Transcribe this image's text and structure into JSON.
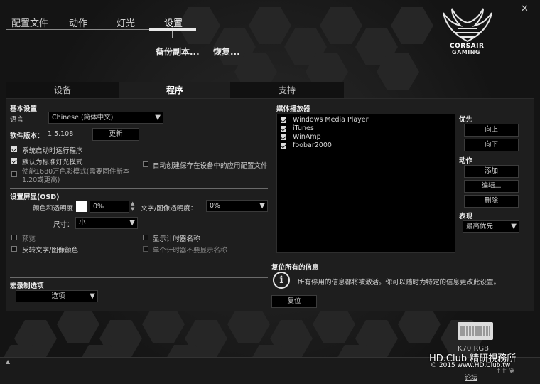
{
  "nav": {
    "tabs": [
      "配置文件",
      "动作",
      "灯光",
      "设置"
    ],
    "sub": [
      "备份副本...",
      "恢复..."
    ]
  },
  "window": {
    "min": "—",
    "close": "✕"
  },
  "logo": {
    "l1": "CORSAIR",
    "l2": "GAMING"
  },
  "tabs": [
    "设备",
    "程序",
    "支持"
  ],
  "basic": {
    "title": "基本设置",
    "lang_label": "语言",
    "lang_value": "Chinese (简体中文)",
    "ver_label": "软件版本：",
    "ver_value": "1.5.108",
    "update": "更新",
    "cb1": "系统启动时运行程序",
    "cb2": "默认为标准灯光模式",
    "cb3": "使能1680万色彩模式(需要固件新本1.20或更高)",
    "cb4": "自动创建保存在设备中的应用配置文件"
  },
  "osd": {
    "title": "设置屏显(OSD)",
    "color_label": "颜色和透明度",
    "color_value": "0%",
    "text_label": "文字/图像透明度：",
    "text_value": "0%",
    "size_label": "尺寸：",
    "size_value": "小",
    "preview": "预览",
    "invert": "反转文字/图像颜色",
    "timer": "显示计时器名称",
    "single": "单个计时器不要显示名称"
  },
  "macro": {
    "title": "宏录制选项",
    "options": "选项"
  },
  "media": {
    "title": "媒体播放器",
    "items": [
      "Windows Media Player",
      "iTunes",
      "WinAmp",
      "foobar2000"
    ],
    "prio": "优先",
    "up": "向上",
    "down": "向下",
    "action": "动作",
    "add": "添加",
    "edit": "编辑...",
    "del": "删除",
    "show": "表现",
    "show_value": "最高优先"
  },
  "reset": {
    "title": "复位所有的信息",
    "text": "所有停用的信息都将被激活。你可以随时为特定的信息更改此设置。",
    "btn": "复位"
  },
  "device": {
    "name": "K70 RGB"
  },
  "forum": "论坛",
  "watermark": {
    "l1": "HD.Club 精研視務所",
    "l2": "© 2015  www.HD.Club.tw"
  }
}
